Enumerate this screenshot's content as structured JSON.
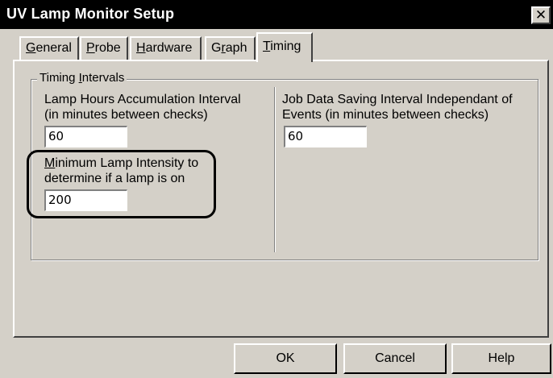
{
  "window": {
    "title": "UV Lamp Monitor Setup",
    "close_symbol": "✕"
  },
  "tabs": [
    {
      "pre": "",
      "key": "G",
      "post": "eneral"
    },
    {
      "pre": "",
      "key": "P",
      "post": "robe"
    },
    {
      "pre": "",
      "key": "H",
      "post": "ardware"
    },
    {
      "pre": "G",
      "key": "r",
      "post": "aph"
    },
    {
      "pre": "",
      "key": "T",
      "post": "iming"
    }
  ],
  "active_tab": "Timing",
  "timing": {
    "group_pre": "Timing ",
    "group_key": "I",
    "group_post": "ntervals",
    "lamp_hours_label_1": "Lamp Hours Accumulation Interval",
    "lamp_hours_label_2": "(in minutes between checks)",
    "lamp_hours_value": "60",
    "min_intensity_key": "M",
    "min_intensity_label_1_rest": "inimum Lamp Intensity to",
    "min_intensity_label_2": "determine if a lamp is on",
    "min_intensity_value": "200",
    "job_data_label_1": "Job Data Saving Interval Independant of",
    "job_data_label_2": "Events (in minutes between checks)",
    "job_data_value": "60"
  },
  "buttons": {
    "ok": "OK",
    "cancel": "Cancel",
    "help": "Help"
  }
}
